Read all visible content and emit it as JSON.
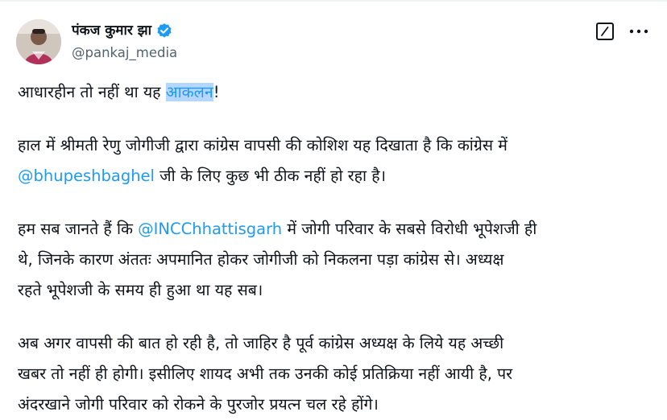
{
  "author": {
    "display_name": "पंकज कुमार झा",
    "handle": "@pankaj_media",
    "verified": true,
    "verified_color": "#1d9bf0"
  },
  "icons": {
    "verified": "verified-badge-icon",
    "edit": "edit-icon",
    "more": "more-options-icon"
  },
  "tweet": {
    "line1_pre": "आधारहीन तो नहीं था यह ",
    "line1_highlight": "आकलन",
    "line1_post": "!",
    "p2_pre": "हाल में श्रीमती रेणु जोगीजी द्वारा कांग्रेस वापसी की कोशिश यह दिखाता है कि कांग्रेस में",
    "p2_mention": "@bhupeshbaghel",
    "p2_post": " जी के लिए कुछ भी ठीक नहीं हो रहा है।",
    "p3_pre": "हम सब जानते हैं कि ",
    "p3_mention": "@INCChhattisgarh",
    "p3_l1_post": " में जोगी परिवार के सबसे विरोधी भूपेशजी ही",
    "p3_l2": "थे, जिनके कारण अंततः अपमानित होकर जोगीजी को निकलना पड़ा कांग्रेस से। अध्यक्ष",
    "p3_l3": "रहते भूपेशजी के समय ही हुआ था यह सब।",
    "p4_l1": "अब अगर वापसी की बात हो रही है, तो जाहिर है पूर्व कांग्रेस अध्यक्ष के लिये यह अच्छी",
    "p4_l2": "खबर तो नहीं ही होगी। इसीलिए शायद अभी तक उनकी कोई प्रतिक्रिया नहीं आयी है, पर",
    "p4_l3": "अंदरखाने जोगी परिवार को रोकने के पुरजोर प्रयत्न चल रहे होंगे।"
  },
  "colors": {
    "mention": "#1d9bf0",
    "highlight_bg": "#b5d7ff",
    "text": "#0f1419",
    "secondary": "#536471"
  }
}
